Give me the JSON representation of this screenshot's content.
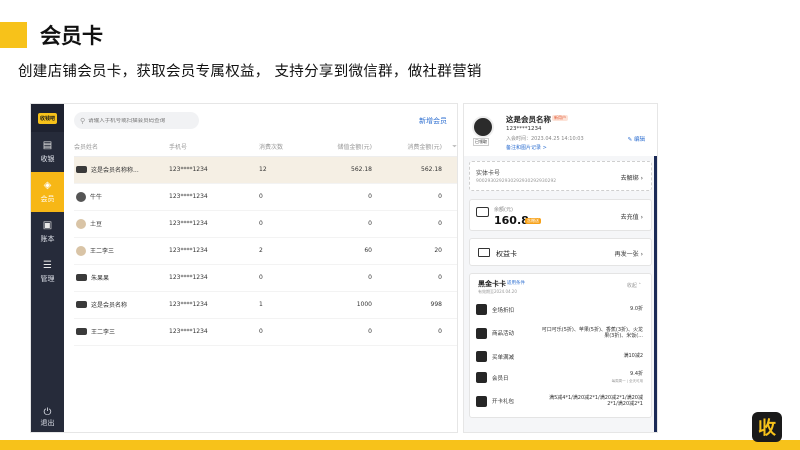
{
  "slide": {
    "title": "会员卡",
    "subtitle": "创建店铺会员卡，获取会员专属权益， 支持分享到微信群，做社群营销",
    "accent_color": "#f7c21a",
    "corner_logo_glyph": "收"
  },
  "sidebar": {
    "brand": "收钱吧",
    "items": [
      {
        "label": "收银",
        "icon": "cashier-icon"
      },
      {
        "label": "会员",
        "icon": "member-icon"
      },
      {
        "label": "账本",
        "icon": "ledger-icon"
      },
      {
        "label": "管理",
        "icon": "settings-icon"
      }
    ],
    "exit_label": "退出",
    "active_index": 1
  },
  "main": {
    "search_placeholder": "请输入手机号或扫描会员码查询",
    "add_member_label": "新增会员",
    "columns": [
      "会员姓名",
      "手机号",
      "消费次数",
      "储值金额(元)",
      "消费金额(元)"
    ],
    "rows": [
      {
        "name": "这是会员名称称...",
        "phone": "123****1234",
        "visits": "12",
        "stored": "562.18",
        "spent": "562.18"
      },
      {
        "name": "牛牛",
        "phone": "123****1234",
        "visits": "0",
        "stored": "0",
        "spent": "0"
      },
      {
        "name": "土豆",
        "phone": "123****1234",
        "visits": "0",
        "stored": "0",
        "spent": "0"
      },
      {
        "name": "王二李三",
        "phone": "123****1234",
        "visits": "2",
        "stored": "60",
        "spent": "20"
      },
      {
        "name": "朱果果",
        "phone": "123****1234",
        "visits": "0",
        "stored": "0",
        "spent": "0"
      },
      {
        "name": "这是会员名称",
        "phone": "123****1234",
        "visits": "1",
        "stored": "1000",
        "spent": "998"
      },
      {
        "name": "王二李三",
        "phone": "123****1234",
        "visits": "0",
        "stored": "0",
        "spent": "0"
      }
    ]
  },
  "panel": {
    "name": "这是会员名称",
    "badge": "新用户",
    "phone": "123****1234",
    "joined": "入会时间：2023.04.25 14:10:03",
    "note_link": "备注和图片记录 >",
    "edit_label": "编辑",
    "card_tag": "已领取",
    "physical_card_label": "实体卡号",
    "physical_card_number": "9002930292930292930292930292",
    "unbind_label": "去解绑",
    "balance_label": "余额(元)",
    "balance_value": "160.8",
    "balance_tag": "含赠送",
    "recharge_label": "去充值",
    "rights_card_label": "权益卡",
    "rights_action": "再发一张",
    "black_card": {
      "title": "黑金卡卡",
      "condition_link": "适用条件",
      "validity": "有效期至2024.04.20",
      "collapse_label": "收起",
      "benefits": [
        {
          "label": "全场折扣",
          "value": "9.0折",
          "sub": "",
          "icon": "discount-icon"
        },
        {
          "label": "商品活动",
          "value": "可口可乐(5折)、苹果(5折)、香蕉(3折)、火龙果(3折)、米饭(...",
          "sub": "",
          "icon": "goods-icon"
        },
        {
          "label": "买单满减",
          "value": "满10减2",
          "sub": "",
          "icon": "reduction-icon"
        },
        {
          "label": "会员日",
          "value": "9.4折",
          "sub": "每周周一 | 全天可用",
          "icon": "member-day-icon"
        },
        {
          "label": "开卡礼包",
          "value": "满5减4*1/满20减2*1/满20减2*1/满20减2*1/满20减2*1",
          "sub": "",
          "icon": "gift-icon"
        }
      ]
    }
  }
}
